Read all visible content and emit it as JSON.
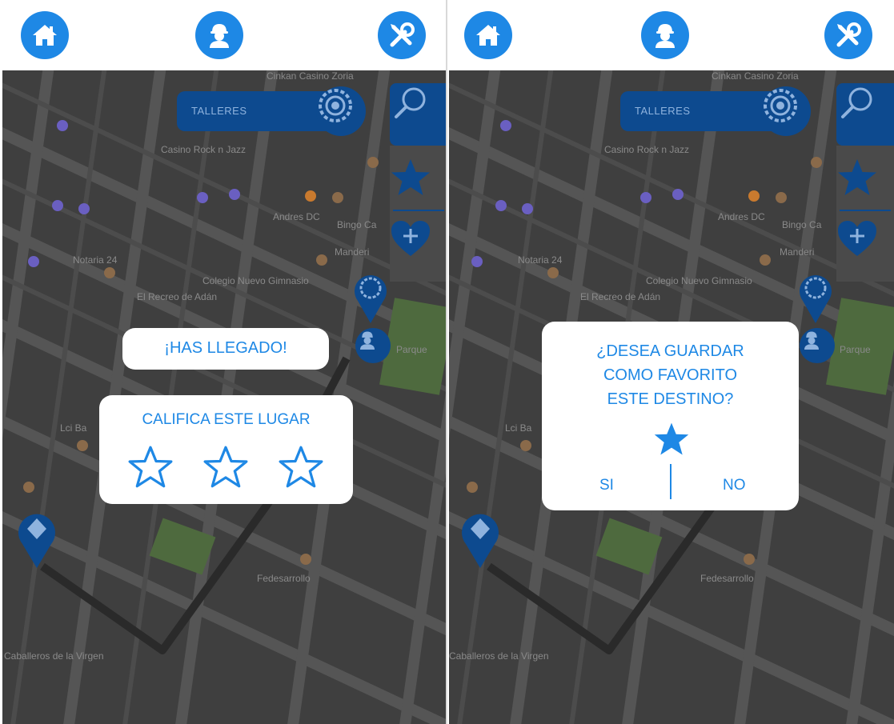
{
  "colors": {
    "accent": "#1e88e5",
    "dark_blue": "#0d4a8f",
    "map_bg": "#3f3f3f",
    "road": "#575757",
    "route": "#2a2a2a",
    "park": "#4e6a3e",
    "card_bg": "#ffffff"
  },
  "icons": {
    "home": "home-icon",
    "user": "worker-icon",
    "tools": "tools-icon",
    "search": "magnifier-icon",
    "gear": "gear-icon",
    "star": "star-icon",
    "heart": "heart-plus-icon",
    "pin": "location-pin-icon"
  },
  "map": {
    "search_placeholder": "TALLERES",
    "labels": {
      "top": "Cinkan Casino Zoria",
      "casino": "Casino Rock n Jazz",
      "notaria": "Notaria 24",
      "andres": "Andres DC",
      "bingo": "Bingo Ca",
      "colegio": "Colegio Nuevo Gimnasio",
      "recreo": "El Recreo de Adán",
      "parque": "Parque",
      "fede": "Fedesarrollo",
      "caballeros": "Caballeros de la Virgen",
      "lci": "Lci Ba",
      "manderi": "Manderi"
    }
  },
  "screen1": {
    "arrived_text": "¡HAS LLEGADO!",
    "rate_title": "CALIFICA ESTE LUGAR",
    "rating": 0,
    "rating_max": 3
  },
  "screen2": {
    "question": [
      "¿DESEA GUARDAR",
      "COMO FAVORITO",
      "ESTE DESTINO?"
    ],
    "yes_label": "SI",
    "no_label": "NO"
  }
}
